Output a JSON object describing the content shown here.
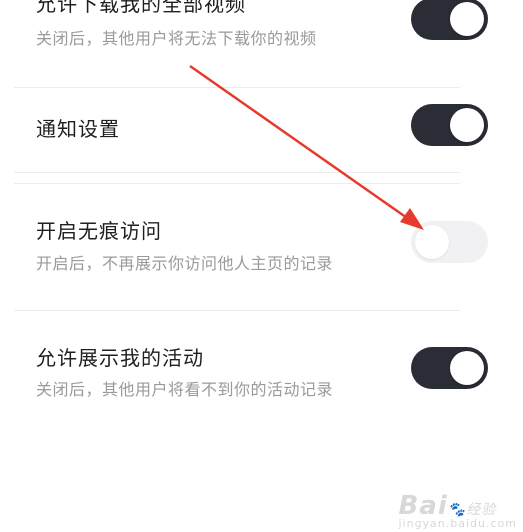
{
  "colors": {
    "toggle_on": "#2b2d36",
    "toggle_off": "#f1f1f3",
    "arrow": "#e63a2e"
  },
  "settings": [
    {
      "title": "允许下载我的全部视频",
      "description": "关闭后，其他用户将无法下载你的视频",
      "on": true
    },
    {
      "title": "通知设置",
      "description": "",
      "on": true
    },
    {
      "title": "开启无痕访问",
      "description": "开启后，不再展示你访问他人主页的记录",
      "on": false
    },
    {
      "title": "允许展示我的活动",
      "description": "关闭后，其他用户将看不到你的活动记录",
      "on": true
    }
  ],
  "watermark": {
    "brand": "Bai",
    "suffix": "经验",
    "url": "jingyan.baidu.com"
  }
}
